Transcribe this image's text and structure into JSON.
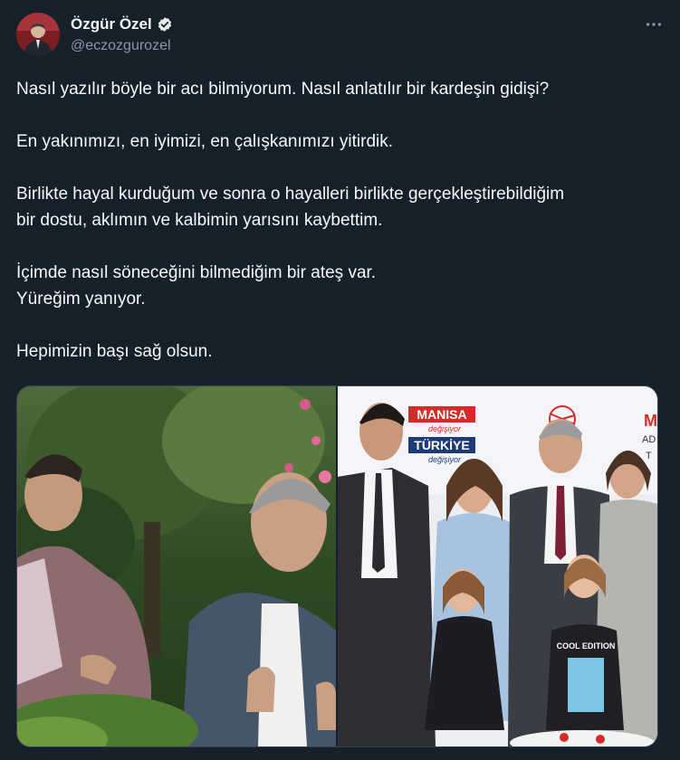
{
  "author": {
    "display_name": "Özgür Özel",
    "handle": "@eczozgurozel",
    "verified": true,
    "avatar_icon": "profile-photo"
  },
  "menu": {
    "more_icon": "more-horizontal-icon"
  },
  "tweet": {
    "paragraphs": [
      [
        "Nasıl yazılır böyle bir acı bilmiyorum. Nasıl anlatılır bir kardeşin gidişi?"
      ],
      [
        "En yakınımızı, en iyimizi, en çalışkanımızı yitirdik."
      ],
      [
        "Birlikte hayal kurduğum ve sonra o hayalleri birlikte gerçekleştirebildiğim",
        "bir dostu, aklımın ve kalbimin yarısını kaybettim."
      ],
      [
        "İçimde nasıl söneceğini bilmediğim bir ateş var.",
        "Yüreğim yanıyor."
      ],
      [
        "Hepimizin başı sağ olsun."
      ]
    ]
  },
  "media": {
    "photo_left": {
      "type": "photo"
    },
    "photo_right": {
      "type": "photo",
      "banner_manisa": "MANISA",
      "banner_manisa_sub": "değişiyor",
      "banner_turkiye": "TÜRKİYE",
      "banner_turkiye_sub": "değişiyor",
      "banner_right": "M",
      "banner_right_2": "AD",
      "banner_right_3": "T",
      "shirt_text": "COOL EDITION"
    }
  },
  "colors": {
    "background": "#15202b",
    "text": "#f7f9f9",
    "secondary": "#8b98a5",
    "verified_badge": "#e7e9ea",
    "border": "#38444d",
    "banner_red": "#d52b2b"
  }
}
